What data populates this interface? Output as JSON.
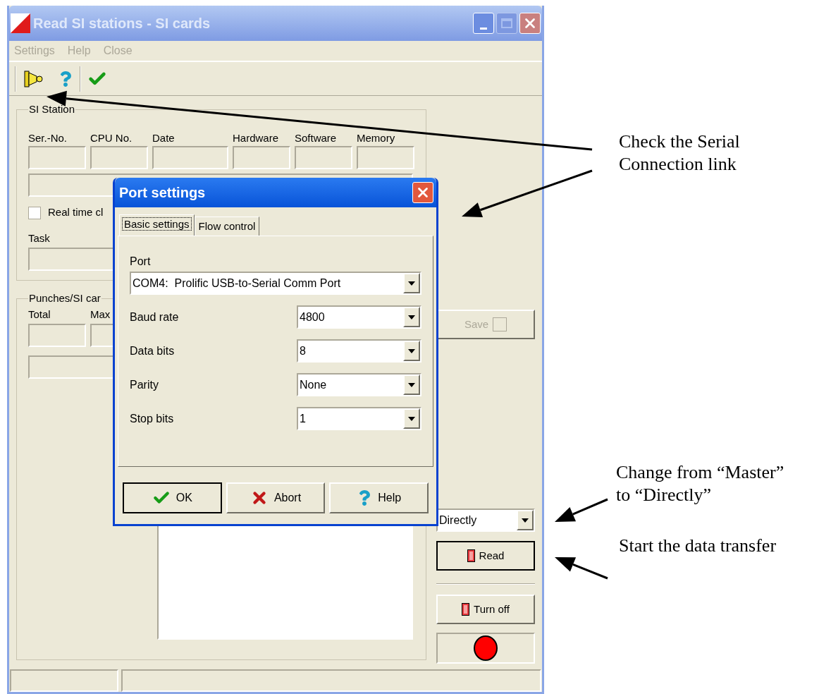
{
  "window": {
    "title": "Read SI stations - SI cards"
  },
  "menu": [
    {
      "label": "Settings",
      "disabled": true
    },
    {
      "label": "Help",
      "disabled": true
    },
    {
      "label": "Close",
      "disabled": true
    }
  ],
  "si_station": {
    "title": "SI Station",
    "columns": [
      "Ser.-No.",
      "CPU No.",
      "Date",
      "Hardware",
      "Software",
      "Memory"
    ],
    "realtime_clock": {
      "label": "Real time cl",
      "checked": false
    },
    "task_label": "Task"
  },
  "punches": {
    "title": "Punches/SI car",
    "columns": [
      "Total",
      "Max"
    ]
  },
  "side": {
    "save": {
      "label": "Save",
      "disabled": true,
      "checked": false
    },
    "mode": {
      "value": "Directly"
    },
    "read": {
      "label": "Read"
    },
    "turn_off": {
      "label": "Turn off"
    },
    "indicator": {
      "on": true
    }
  },
  "dialog": {
    "title": "Port settings",
    "tabs": [
      {
        "label": "Basic settings",
        "selected": true
      },
      {
        "label": "Flow control",
        "selected": false
      }
    ],
    "port": {
      "label": "Port",
      "value": "COM4:  Prolific USB-to-Serial Comm Port"
    },
    "fields": [
      {
        "label": "Baud rate",
        "value": "4800"
      },
      {
        "label": "Data bits",
        "value": "8"
      },
      {
        "label": "Parity",
        "value": "None"
      },
      {
        "label": "Stop bits",
        "value": "1"
      }
    ],
    "buttons": [
      {
        "kind": "ok",
        "label": "OK",
        "default": true
      },
      {
        "kind": "abort",
        "label": "Abort",
        "default": false
      },
      {
        "kind": "help",
        "label": "Help",
        "default": false
      }
    ]
  },
  "annotations": [
    {
      "text": "Check the Serial Connection link"
    },
    {
      "text": "Change from “Master” to “Directly”"
    },
    {
      "text": "Start the data transfer"
    }
  ]
}
